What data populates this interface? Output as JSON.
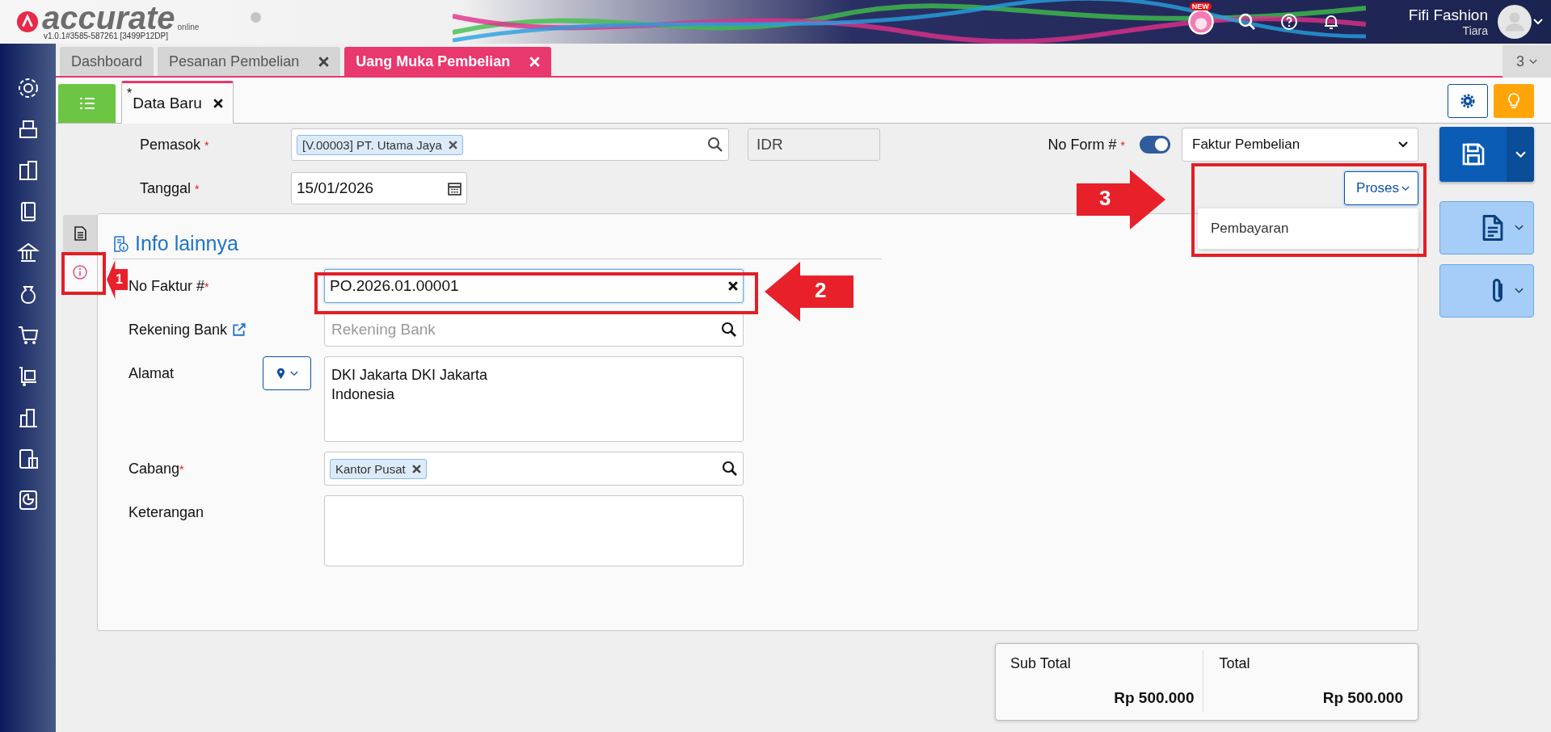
{
  "header": {
    "logo": "accurate",
    "logo_sub": "online",
    "version": "v1.0.1#3585-587261 [3499P12DP]",
    "badge": "NEW",
    "company": "Fifi Fashion",
    "user": "Tiara"
  },
  "tabs": [
    {
      "label": "Dashboard",
      "closable": false,
      "selected": false
    },
    {
      "label": "Pesanan Pembelian",
      "closable": true,
      "selected": false
    },
    {
      "label": "Uang Muka Pembelian",
      "closable": true,
      "selected": true
    }
  ],
  "tab_count": "3",
  "subtabs": [
    {
      "label": "Data Baru",
      "marker": "*",
      "selected": true
    }
  ],
  "form": {
    "pemasok": {
      "label": "Pemasok",
      "mark": "*",
      "chip": "[V.00003] PT. Utama Jaya"
    },
    "currency": {
      "value": "IDR",
      "disabled": true
    },
    "no_form": {
      "label": "No Form #",
      "mark": "*",
      "auto": true,
      "type": "Faktur Pembelian"
    },
    "tanggal": {
      "label": "Tanggal",
      "mark": "*",
      "value": "15/01/2026"
    },
    "proses": {
      "label": "Proses",
      "expanded": true,
      "menu": [
        "Pembayaran"
      ]
    }
  },
  "panel": {
    "side_tabs": [
      {
        "kind": "document",
        "selected": false
      },
      {
        "kind": "info",
        "selected": true
      }
    ],
    "title": "Info lainnya",
    "fields": [
      {
        "kind": "text",
        "label": "No Faktur #",
        "mark": "*",
        "value": "PO.2026.01.00001"
      },
      {
        "kind": "lookup",
        "label": "Rekening Bank",
        "link": true,
        "placeholder": "Rekening Bank"
      },
      {
        "kind": "address",
        "label": "Alamat",
        "value": "DKI Jakarta DKI Jakarta\nIndonesia"
      },
      {
        "kind": "chip",
        "label": "Cabang",
        "mark": "*",
        "chip": "Kantor Pusat"
      },
      {
        "kind": "area",
        "label": "Keterangan"
      }
    ]
  },
  "totals": [
    {
      "label": "Sub Total",
      "value": "Rp 500.000"
    },
    {
      "label": "Total",
      "value": "Rp 500.000"
    }
  ],
  "callouts": [
    {
      "number": "1",
      "kind": "left"
    },
    {
      "number": "2",
      "kind": "left"
    },
    {
      "number": "3",
      "kind": "right"
    }
  ]
}
